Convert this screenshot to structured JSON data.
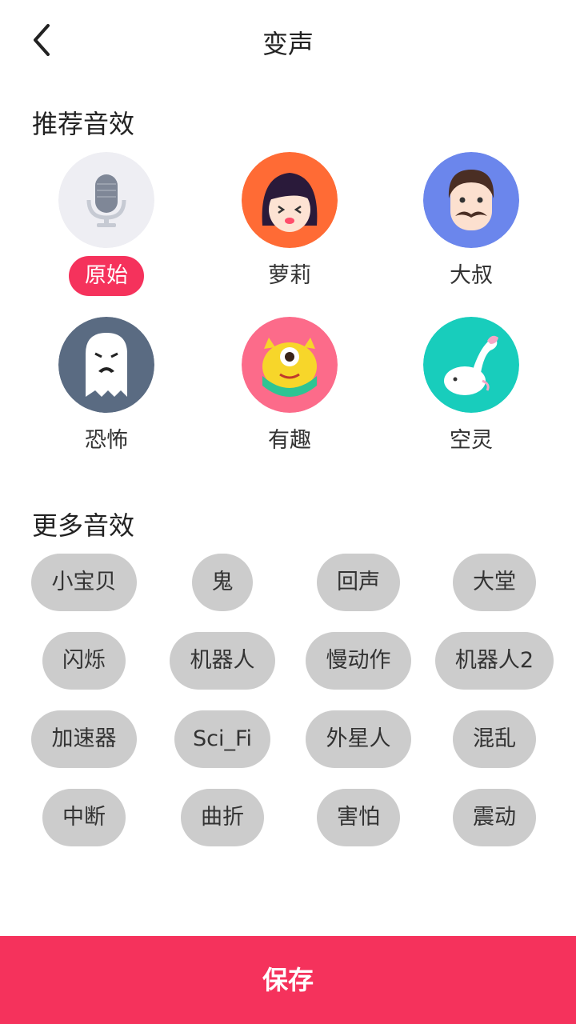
{
  "header": {
    "title": "变声",
    "back_icon": "chevron-left-icon"
  },
  "recommended": {
    "title": "推荐音效",
    "items": [
      {
        "label": "原始",
        "icon": "microphone-icon",
        "selected": true,
        "bg": "#eeeef3"
      },
      {
        "label": "萝莉",
        "icon": "girl-face-icon",
        "selected": false,
        "bg": "#ff6b35"
      },
      {
        "label": "大叔",
        "icon": "uncle-mustache-icon",
        "selected": false,
        "bg": "#6b86ec"
      },
      {
        "label": "恐怖",
        "icon": "ghost-icon",
        "selected": false,
        "bg": "#5a6b82"
      },
      {
        "label": "有趣",
        "icon": "monster-icon",
        "selected": false,
        "bg": "#fc6b8a"
      },
      {
        "label": "空灵",
        "icon": "fish-icon",
        "selected": false,
        "bg": "#18cdbc"
      }
    ]
  },
  "more": {
    "title": "更多音效",
    "items": [
      "小宝贝",
      "鬼",
      "回声",
      "大堂",
      "闪烁",
      "机器人",
      "慢动作",
      "机器人2",
      "加速器",
      "Sci_Fi",
      "外星人",
      "混乱",
      "中断",
      "曲折",
      "害怕",
      "震动"
    ]
  },
  "footer": {
    "save_label": "保存"
  },
  "colors": {
    "accent": "#f5325c",
    "chip_bg": "#cccccc"
  }
}
